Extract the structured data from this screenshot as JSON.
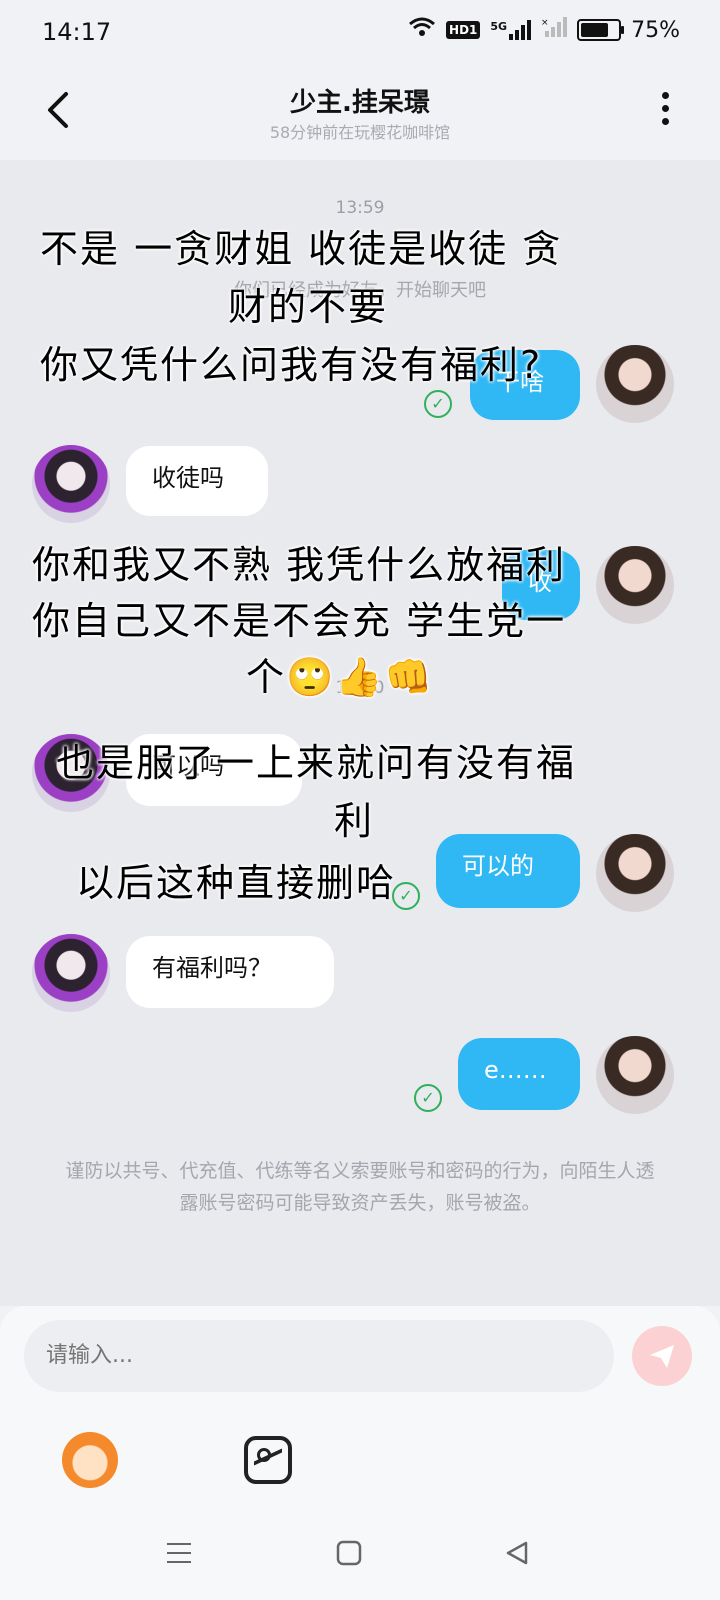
{
  "status_bar": {
    "time": "14:17",
    "hd_label": "HD1",
    "network": "5G",
    "battery": "75%",
    "battery_level": 0.75
  },
  "header": {
    "title": "少主.挂呆璟",
    "subtitle": "58分钟前在玩樱花咖啡馆"
  },
  "chat": {
    "timestamp_1": "13:59",
    "system_message": "你们已经成为好友，开始聊天吧",
    "timestamp_2": "14:10",
    "messages": [
      {
        "side": "right",
        "text": "干啥"
      },
      {
        "side": "left",
        "text": "收徒吗"
      },
      {
        "side": "right",
        "text": "收"
      },
      {
        "side": "left",
        "text": "可以吗"
      },
      {
        "side": "right",
        "text": "可以的"
      },
      {
        "side": "left",
        "text": "有福利吗？"
      },
      {
        "side": "right",
        "text": "e……"
      }
    ]
  },
  "overlay_text": {
    "line1": "不是 一贪财姐 收徒是收徒 贪",
    "line2": "财的不要",
    "line3": "你又凭什么问我有没有福利?",
    "line4": "你和我又不熟 我凭什么放福利",
    "line5": "你自己又不是不会充 学生党一",
    "line6": "个🙄👍👊",
    "line7": "也是服了一上来就问有没有福",
    "line8": "利",
    "line9": "以后这种直接删哈"
  },
  "warning": "谨防以共号、代充值、代练等名义索要账号和密码的行为，向陌生人透露账号密码可能导致资产丢失，账号被盗。",
  "input_bar": {
    "placeholder": "请输入..."
  },
  "colors": {
    "bubble_right": "#2fb8f4",
    "bubble_left": "#ffffff",
    "read_check": "#2fb05a",
    "send_button": "#fbd1d3"
  }
}
